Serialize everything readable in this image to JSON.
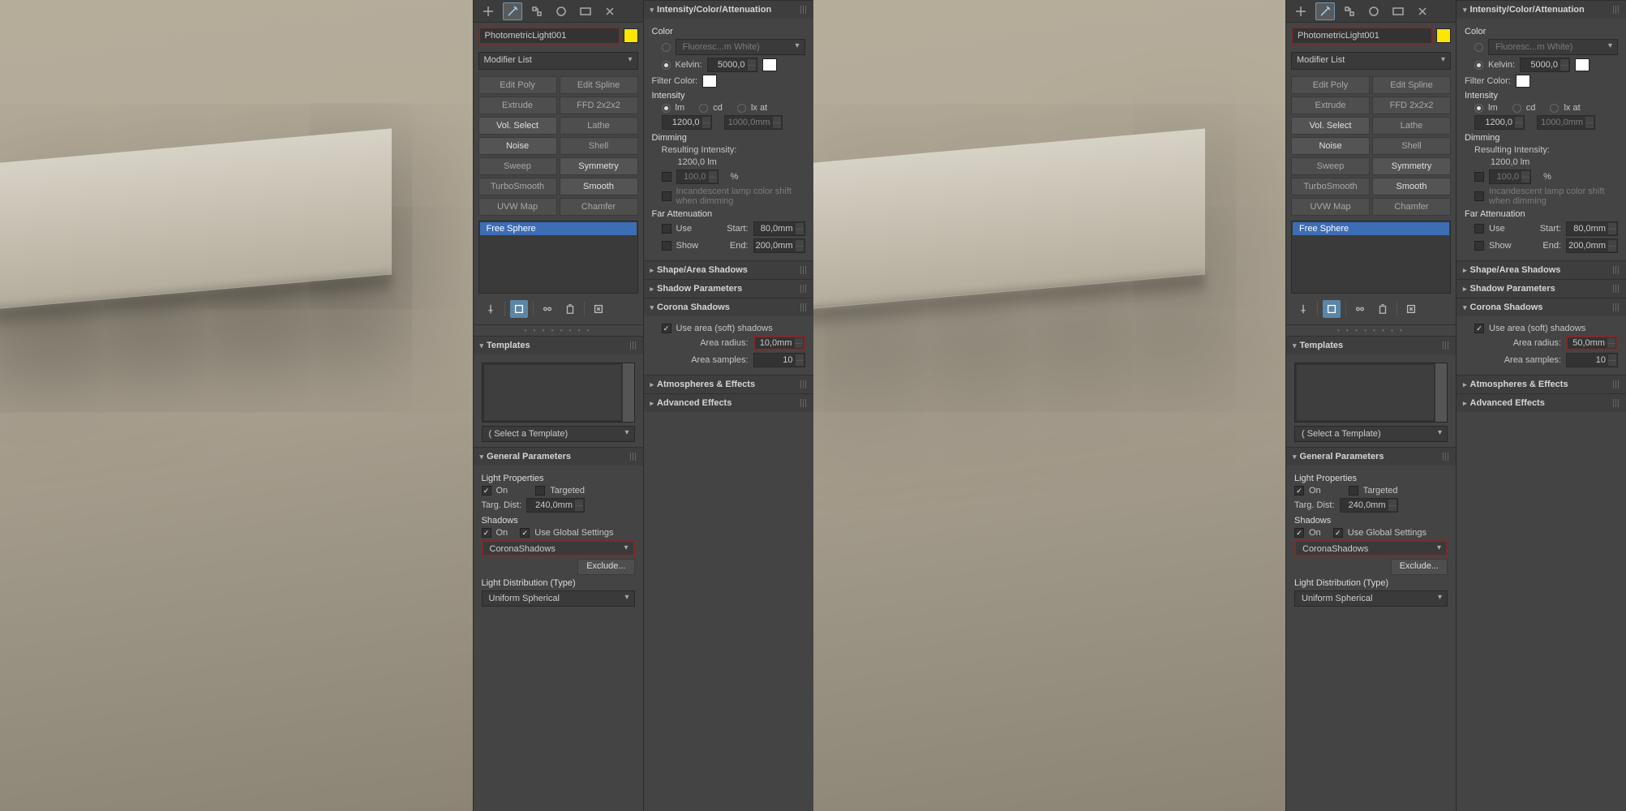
{
  "object_name": "PhotometricLight001",
  "modifier_list_label": "Modifier List",
  "modifier_buttons": [
    {
      "label": "Edit Poly",
      "enabled": false
    },
    {
      "label": "Edit Spline",
      "enabled": false
    },
    {
      "label": "Extrude",
      "enabled": false
    },
    {
      "label": "FFD 2x2x2",
      "enabled": false
    },
    {
      "label": "Vol. Select",
      "enabled": true
    },
    {
      "label": "Lathe",
      "enabled": false
    },
    {
      "label": "Noise",
      "enabled": true
    },
    {
      "label": "Shell",
      "enabled": false
    },
    {
      "label": "Sweep",
      "enabled": false
    },
    {
      "label": "Symmetry",
      "enabled": true
    },
    {
      "label": "TurboSmooth",
      "enabled": false
    },
    {
      "label": "Smooth",
      "enabled": true
    },
    {
      "label": "UVW Map",
      "enabled": false
    },
    {
      "label": "Chamfer",
      "enabled": false
    }
  ],
  "stack_item": "Free Sphere",
  "templates": {
    "title": "Templates",
    "placeholder": "( Select a Template)"
  },
  "general": {
    "title": "General Parameters",
    "light_props": "Light Properties",
    "on": "On",
    "targeted": "Targeted",
    "targ_dist_label": "Targ. Dist:",
    "targ_dist": "240,0mm",
    "shadows": "Shadows",
    "use_global": "Use Global Settings",
    "shadow_type": "CoronaShadows",
    "exclude": "Exclude...",
    "light_dist": "Light Distribution (Type)",
    "dist_val": "Uniform Spherical"
  },
  "ica": {
    "title": "Intensity/Color/Attenuation",
    "color_label": "Color",
    "preset": "Fluoresc...m White)",
    "kelvin_label": "Kelvin:",
    "kelvin": "5000,0",
    "filter_color": "Filter Color:",
    "intensity": "Intensity",
    "u_lm": "lm",
    "u_cd": "cd",
    "u_lx": "lx at",
    "int_val": "1200,0",
    "int_at": "1000,0mm",
    "dimming": "Dimming",
    "resulting": "Resulting Intensity:",
    "res_val": "1200,0 lm",
    "pct": "100,0",
    "pct_unit": "%",
    "incandescent": "Incandescent lamp color shift when dimming",
    "far_att": "Far Attenuation",
    "use": "Use",
    "show": "Show",
    "start": "Start:",
    "start_v": "80,0mm",
    "end": "End:",
    "end_v": "200,0mm"
  },
  "rollouts_right": {
    "shape": "Shape/Area Shadows",
    "shadow_params": "Shadow Parameters",
    "corona": "Corona Shadows",
    "use_area": "Use area (soft) shadows",
    "area_radius": "Area radius:",
    "area_samples": "Area samples:",
    "samples_val": "10",
    "atmos": "Atmospheres & Effects",
    "adv": "Advanced Effects"
  },
  "left_radius": "10,0mm",
  "right_radius": "50,0mm"
}
